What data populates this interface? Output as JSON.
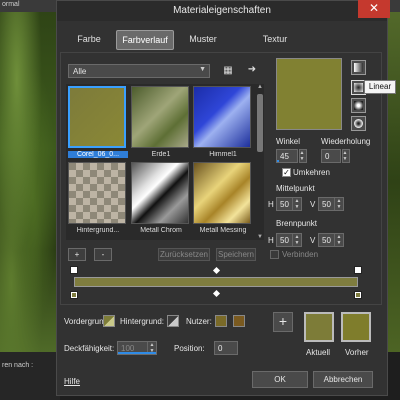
{
  "background": {
    "mode_label": "ormal",
    "status_text": "ren nach :"
  },
  "dialog": {
    "title": "Materialeigenschaften",
    "tabs": [
      {
        "label": "Farbe"
      },
      {
        "label": "Farbverlauf",
        "active": true
      },
      {
        "label": "Muster"
      },
      {
        "label": "Textur"
      }
    ],
    "category": "Alle",
    "gallery": [
      {
        "label": "Corel_06_0...",
        "selected": true
      },
      {
        "label": "Erde1"
      },
      {
        "label": "Himmel1"
      },
      {
        "label": "Hintergrund..."
      },
      {
        "label": "Metall Chrom"
      },
      {
        "label": "Metall Messing"
      }
    ],
    "buttons": {
      "add": "+",
      "remove": "-",
      "reset": "Zurücksetzen",
      "save": "Speichern",
      "link": "Verbinden",
      "ok": "OK",
      "cancel": "Abbrechen",
      "help": "Hilfe",
      "swap": "+"
    },
    "tooltip": "Linear",
    "angle": {
      "label": "Winkel",
      "value": "45"
    },
    "repeat": {
      "label": "Wiederholung",
      "value": "0"
    },
    "invert": {
      "label": "Umkehren",
      "checked": true
    },
    "center": {
      "label": "Mittelpunkt",
      "h_label": "H",
      "h": "50",
      "v_label": "V",
      "v": "50"
    },
    "focus": {
      "label": "Brennpunkt",
      "h_label": "H",
      "h": "50",
      "v_label": "V",
      "v": "50"
    },
    "foreground_label": "Vordergrund:",
    "background_label": "Hintergrund:",
    "user_label": "Nutzer:",
    "opacity": {
      "label": "Deckfähigkeit:",
      "value": "100",
      "level": 1.0
    },
    "position": {
      "label": "Position:",
      "value": "0"
    },
    "current_label": "Aktuell",
    "previous_label": "Vorher",
    "colors": {
      "gradient_main": "#818132",
      "previous": "#7f7d2c",
      "accent": "#2f8be6",
      "user_a": "#7a6a28",
      "user_b": "#7a5a20"
    }
  }
}
